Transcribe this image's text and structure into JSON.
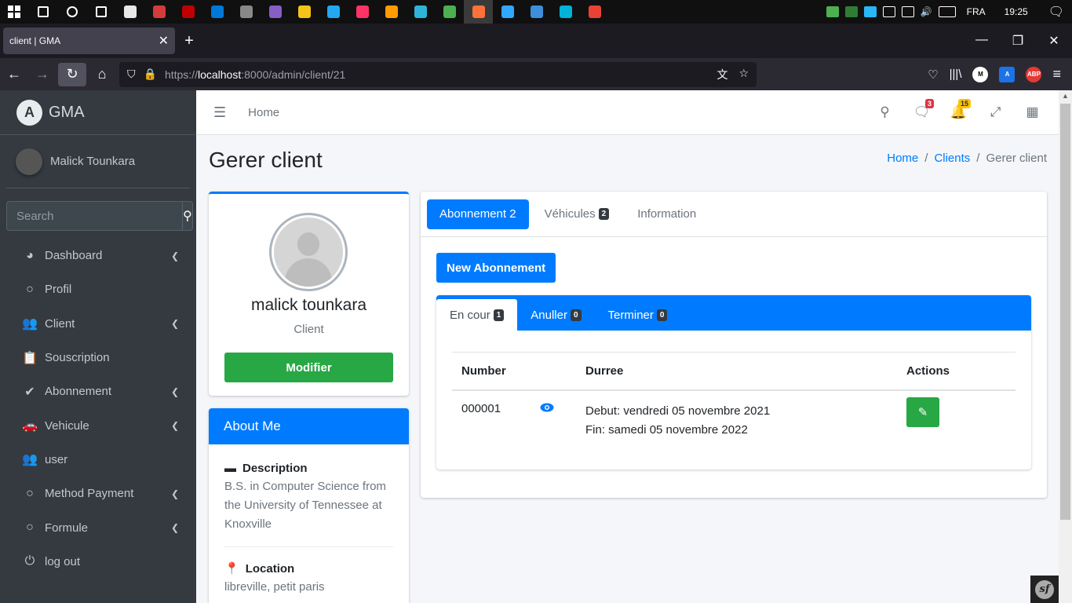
{
  "taskbar": {
    "icons": [
      {
        "name": "search-icon",
        "color": "#ffffff"
      },
      {
        "name": "cortana-icon",
        "color": "#ffffff"
      },
      {
        "name": "task-view-icon",
        "color": "#ffffff"
      },
      {
        "name": "store-icon",
        "color": "#e8e8e8"
      },
      {
        "name": "cloud-app-icon",
        "color": "#d23c3c"
      },
      {
        "name": "filezilla-icon",
        "color": "#bf0000"
      },
      {
        "name": "mail-icon",
        "color": "#0078d7"
      },
      {
        "name": "media-icon",
        "color": "#888888"
      },
      {
        "name": "visual-studio-icon",
        "color": "#865fc5"
      },
      {
        "name": "file-explorer-icon",
        "color": "#f5c518"
      },
      {
        "name": "vscode-icon",
        "color": "#23a9f2"
      },
      {
        "name": "indesign-icon",
        "color": "#ff3366"
      },
      {
        "name": "illustrator-icon",
        "color": "#ff9a00"
      },
      {
        "name": "edge-icon",
        "color": "#2fb4d8"
      },
      {
        "name": "app-icon",
        "color": "#4caf50"
      },
      {
        "name": "firefox-icon",
        "color": "#ff7139"
      },
      {
        "name": "photoshop-icon",
        "color": "#31a8ff"
      },
      {
        "name": "terminal-icon",
        "color": "#3c8fd8"
      },
      {
        "name": "remote-icon",
        "color": "#00b4d8"
      },
      {
        "name": "chrome-icon",
        "color": "#e94235"
      }
    ],
    "lang": "FRA",
    "time": "19:25"
  },
  "browser": {
    "tab_title": "client | GMA",
    "url_scheme": "https://",
    "url_host": "localhost",
    "url_path": ":8000/admin/client/21",
    "ext_m": "M",
    "ext_abp": "ABP"
  },
  "sidebar": {
    "brand": "GMA",
    "brand_logo": "A",
    "user": "Malick Tounkara",
    "search_placeholder": "Search",
    "items": [
      {
        "label": "Dashboard",
        "icon": "◕",
        "arrow": true
      },
      {
        "label": "Profil",
        "icon": "○",
        "arrow": false
      },
      {
        "label": "Client",
        "icon": "👥",
        "arrow": true
      },
      {
        "label": "Souscription",
        "icon": "📋",
        "arrow": false
      },
      {
        "label": "Abonnement",
        "icon": "✔",
        "arrow": true
      },
      {
        "label": "Vehicule",
        "icon": "🚗",
        "arrow": true
      },
      {
        "label": "user",
        "icon": "👥",
        "arrow": false
      },
      {
        "label": "Method Payment",
        "icon": "○",
        "arrow": true
      },
      {
        "label": "Formule",
        "icon": "○",
        "arrow": true
      },
      {
        "label": "log out",
        "icon": "⏻",
        "arrow": false
      }
    ]
  },
  "header": {
    "home": "Home",
    "messages_badge": "3",
    "notifications_badge": "15"
  },
  "page": {
    "title": "Gerer client",
    "breadcrumb": [
      "Home",
      "Clients",
      "Gerer client"
    ]
  },
  "profile": {
    "name": "malick tounkara",
    "role": "Client",
    "edit_button": "Modifier"
  },
  "about": {
    "title": "About Me",
    "description_label": "Description",
    "description": "B.S. in Computer Science from the University of Tennessee at Knoxville",
    "location_label": "Location",
    "location": "libreville, petit paris"
  },
  "tabs": [
    {
      "label": "Abonnement 2",
      "badge": null,
      "active": true
    },
    {
      "label": "Véhicules",
      "badge": "2",
      "active": false
    },
    {
      "label": "Information",
      "badge": null,
      "active": false
    }
  ],
  "new_button": "New Abonnement",
  "subtabs": [
    {
      "label": "En cour",
      "badge": "1",
      "active": true
    },
    {
      "label": "Anuller",
      "badge": "0",
      "active": false
    },
    {
      "label": "Terminer",
      "badge": "0",
      "active": false
    }
  ],
  "table": {
    "headers": [
      "Number",
      "Durree",
      "Actions"
    ],
    "rows": [
      {
        "number": "000001",
        "debut": "Debut: vendredi 05 novembre 2021",
        "fin": "Fin: samedi 05 novembre 2022"
      }
    ]
  },
  "colors": {
    "primary": "#007bff",
    "success": "#28a745",
    "sidebar": "#343a40",
    "danger": "#dc3545",
    "warning": "#ffc107"
  }
}
